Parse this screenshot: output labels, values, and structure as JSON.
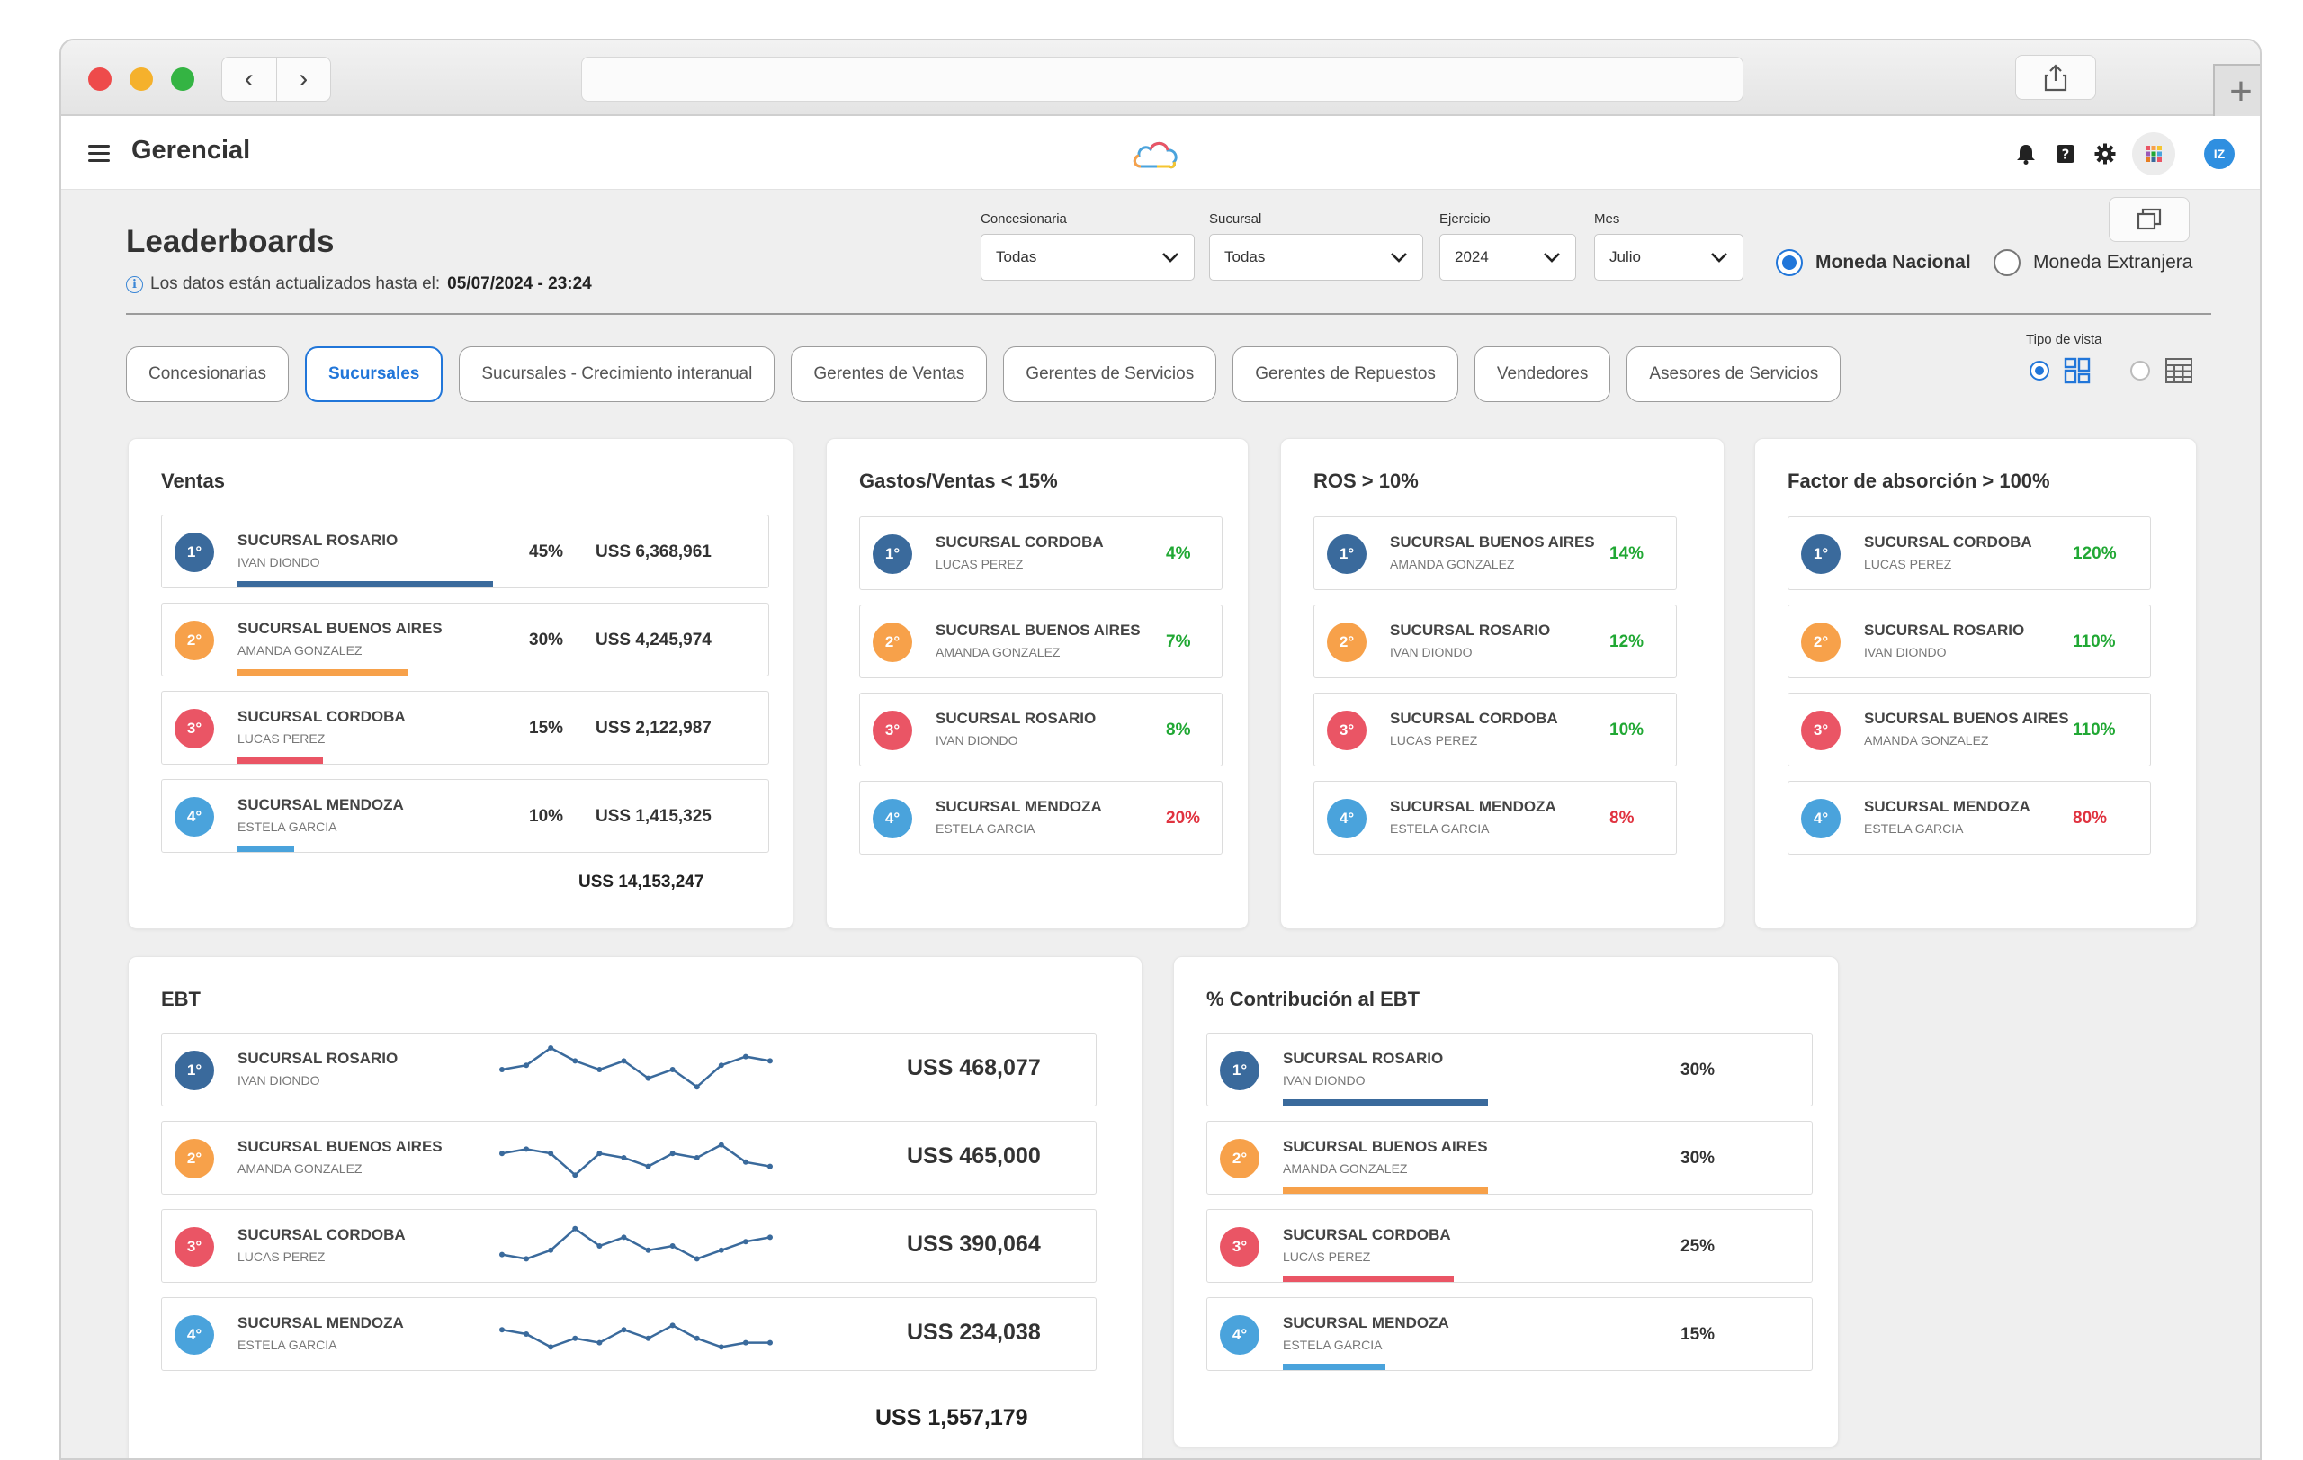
{
  "app": {
    "title": "Gerencial",
    "avatar_initials": "IZ"
  },
  "colors": {
    "accent": "#2176d9",
    "rank1": "#3a6a9c",
    "rank2": "#f7a14a",
    "rank3": "#ea5565",
    "rank4": "#4aa3dc",
    "positive": "#21a834",
    "negative": "#e0323f"
  },
  "page": {
    "title": "Leaderboards",
    "updated_label": "Los datos están actualizados hasta el:",
    "updated_value": "05/07/2024 - 23:24"
  },
  "filters": [
    {
      "label": "Concesionaria",
      "value": "Todas"
    },
    {
      "label": "Sucursal",
      "value": "Todas"
    },
    {
      "label": "Ejercicio",
      "value": "2024"
    },
    {
      "label": "Mes",
      "value": "Julio"
    }
  ],
  "currency": {
    "national": "Moneda Nacional",
    "foreign": "Moneda Extranjera",
    "selected": "national"
  },
  "tabs": [
    {
      "label": "Concesionarias",
      "active": false
    },
    {
      "label": "Sucursales",
      "active": true
    },
    {
      "label": "Sucursales - Crecimiento interanual",
      "active": false
    },
    {
      "label": "Gerentes de Ventas",
      "active": false
    },
    {
      "label": "Gerentes de Servicios",
      "active": false
    },
    {
      "label": "Gerentes de Repuestos",
      "active": false
    },
    {
      "label": "Vendedores",
      "active": false
    },
    {
      "label": "Asesores de Servicios",
      "active": false
    }
  ],
  "view": {
    "label": "Tipo de vista",
    "selected": "cards"
  },
  "ventas": {
    "title": "Ventas",
    "rows": [
      {
        "rank": "1°",
        "name": "SUCURSAL ROSARIO",
        "person": "IVAN DIONDO",
        "pct": "45%",
        "amount": "USS 6,368,961",
        "share": 0.45
      },
      {
        "rank": "2°",
        "name": "SUCURSAL BUENOS AIRES",
        "person": "AMANDA GONZALEZ",
        "pct": "30%",
        "amount": "USS 4,245,974",
        "share": 0.3
      },
      {
        "rank": "3°",
        "name": "SUCURSAL CORDOBA",
        "person": "LUCAS PEREZ",
        "pct": "15%",
        "amount": "USS 2,122,987",
        "share": 0.15
      },
      {
        "rank": "4°",
        "name": "SUCURSAL MENDOZA",
        "person": "ESTELA GARCIA",
        "pct": "10%",
        "amount": "USS 1,415,325",
        "share": 0.1
      }
    ],
    "total": "USS 14,153,247"
  },
  "gastos": {
    "title": "Gastos/Ventas < 15%",
    "rows": [
      {
        "rank": "1°",
        "name": "SUCURSAL CORDOBA",
        "person": "LUCAS PEREZ",
        "value": "4%",
        "status": "positive"
      },
      {
        "rank": "2°",
        "name": "SUCURSAL BUENOS AIRES",
        "person": "AMANDA GONZALEZ",
        "value": "7%",
        "status": "positive"
      },
      {
        "rank": "3°",
        "name": "SUCURSAL ROSARIO",
        "person": "IVAN DIONDO",
        "value": "8%",
        "status": "positive"
      },
      {
        "rank": "4°",
        "name": "SUCURSAL MENDOZA",
        "person": "ESTELA GARCIA",
        "value": "20%",
        "status": "negative"
      }
    ]
  },
  "ros": {
    "title": "ROS > 10%",
    "rows": [
      {
        "rank": "1°",
        "name": "SUCURSAL BUENOS AIRES",
        "person": "AMANDA GONZALEZ",
        "value": "14%",
        "status": "positive"
      },
      {
        "rank": "2°",
        "name": "SUCURSAL ROSARIO",
        "person": "IVAN DIONDO",
        "value": "12%",
        "status": "positive"
      },
      {
        "rank": "3°",
        "name": "SUCURSAL CORDOBA",
        "person": "LUCAS PEREZ",
        "value": "10%",
        "status": "positive"
      },
      {
        "rank": "4°",
        "name": "SUCURSAL MENDOZA",
        "person": "ESTELA GARCIA",
        "value": "8%",
        "status": "negative"
      }
    ]
  },
  "factor": {
    "title": "Factor de absorción > 100%",
    "rows": [
      {
        "rank": "1°",
        "name": "SUCURSAL CORDOBA",
        "person": "LUCAS PEREZ",
        "value": "120%",
        "status": "positive"
      },
      {
        "rank": "2°",
        "name": "SUCURSAL ROSARIO",
        "person": "IVAN DIONDO",
        "value": "110%",
        "status": "positive"
      },
      {
        "rank": "3°",
        "name": "SUCURSAL BUENOS AIRES",
        "person": "AMANDA GONZALEZ",
        "value": "110%",
        "status": "positive"
      },
      {
        "rank": "4°",
        "name": "SUCURSAL MENDOZA",
        "person": "ESTELA GARCIA",
        "value": "80%",
        "status": "negative"
      }
    ]
  },
  "ebt": {
    "title": "EBT",
    "rows": [
      {
        "rank": "1°",
        "name": "SUCURSAL ROSARIO",
        "person": "IVAN DIONDO",
        "amount": "USS 468,077",
        "trend": [
          5,
          6,
          10,
          7,
          5,
          7,
          3,
          5,
          1,
          6,
          8,
          7
        ]
      },
      {
        "rank": "2°",
        "name": "SUCURSAL BUENOS AIRES",
        "person": "AMANDA GONZALEZ",
        "amount": "USS 465,000",
        "trend": [
          6,
          7,
          6,
          1,
          6,
          5,
          3,
          6,
          5,
          8,
          4,
          3
        ]
      },
      {
        "rank": "3°",
        "name": "SUCURSAL CORDOBA",
        "person": "LUCAS PEREZ",
        "amount": "USS 390,064",
        "trend": [
          3,
          2,
          4,
          9,
          5,
          7,
          4,
          5,
          2,
          4,
          6,
          7
        ]
      },
      {
        "rank": "4°",
        "name": "SUCURSAL MENDOZA",
        "person": "ESTELA GARCIA",
        "amount": "USS 234,038",
        "trend": [
          6,
          5,
          2,
          4,
          3,
          6,
          4,
          7,
          4,
          2,
          3,
          3
        ]
      }
    ],
    "total": "USS 1,557,179"
  },
  "contrib": {
    "title": "% Contribución al EBT",
    "rows": [
      {
        "rank": "1°",
        "name": "SUCURSAL ROSARIO",
        "person": "IVAN DIONDO",
        "pct": "30%",
        "share": 0.3
      },
      {
        "rank": "2°",
        "name": "SUCURSAL BUENOS AIRES",
        "person": "AMANDA GONZALEZ",
        "pct": "30%",
        "share": 0.3
      },
      {
        "rank": "3°",
        "name": "SUCURSAL CORDOBA",
        "person": "LUCAS PEREZ",
        "pct": "25%",
        "share": 0.25
      },
      {
        "rank": "4°",
        "name": "SUCURSAL MENDOZA",
        "person": "ESTELA GARCIA",
        "pct": "15%",
        "share": 0.15
      }
    ]
  }
}
